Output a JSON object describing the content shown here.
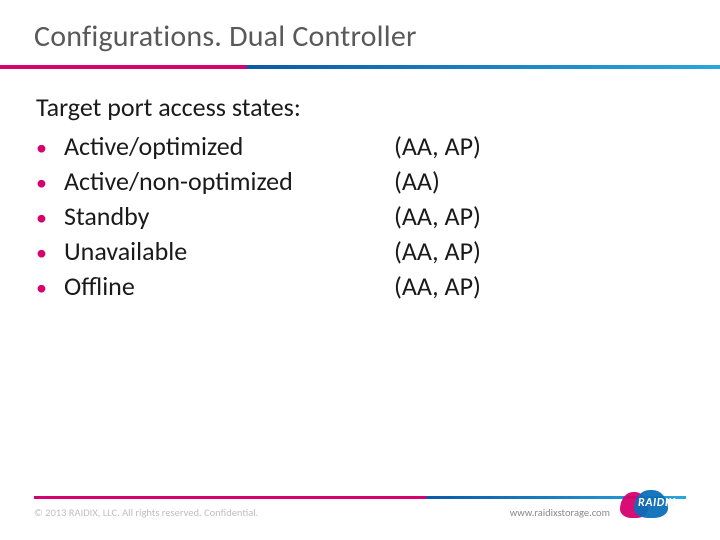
{
  "title": "Configurations. Dual Controller",
  "intro": "Target port access states:",
  "states": [
    {
      "name": "Active/optimized",
      "modes": "(AA, AP)"
    },
    {
      "name": "Active/non-optimized",
      "modes": "(AA)"
    },
    {
      "name": "Standby",
      "modes": "(AA, AP)"
    },
    {
      "name": "Unavailable",
      "modes": "(AA, AP)"
    },
    {
      "name": "Offline",
      "modes": "(AA, AP)"
    }
  ],
  "footer": {
    "copyright": "© 2013 RAIDIX, LLC. All rights reserved. Confidential.",
    "url": "www.raidixstorage.com",
    "logo_text": "RAIDIX"
  }
}
